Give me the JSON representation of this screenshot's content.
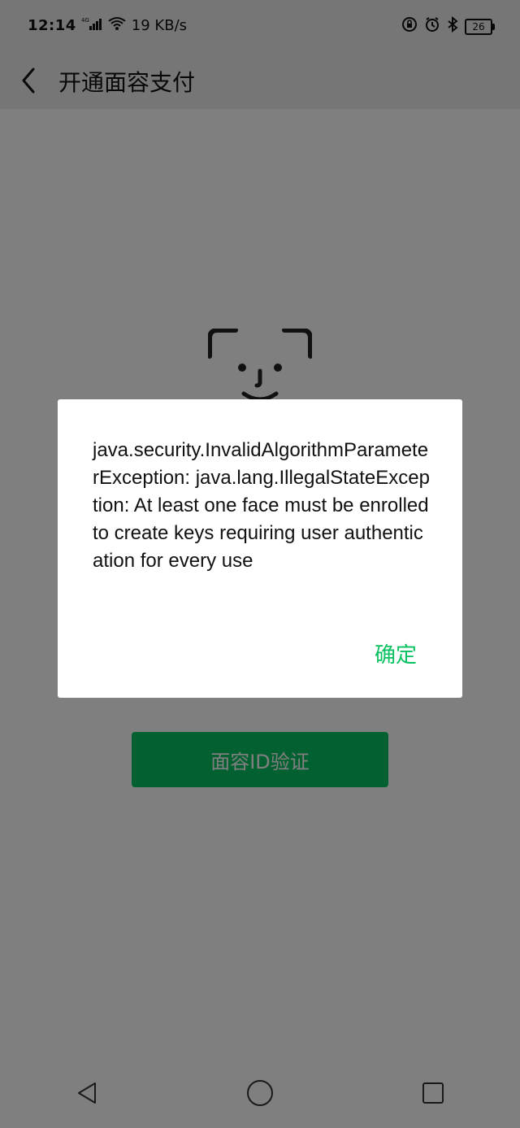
{
  "status_bar": {
    "time": "12:14",
    "network": "4G",
    "speed": "19 KB/s",
    "battery": "26"
  },
  "header": {
    "title": "开通面容支付"
  },
  "main": {
    "face_icon": "face-id-icon",
    "button_label": "面容ID验证"
  },
  "dialog": {
    "message": "java.security.InvalidAlgorithmParameterException: java.lang.IllegalStateException: At least one face must be enrolled to create keys requiring user authentication for every use",
    "confirm_label": "确定"
  },
  "colors": {
    "accent": "#07c160",
    "overlay": "#000000"
  },
  "navigation": {
    "back_icon": "triangle-back-icon",
    "home_icon": "circle-home-icon",
    "recents_icon": "square-recents-icon"
  }
}
